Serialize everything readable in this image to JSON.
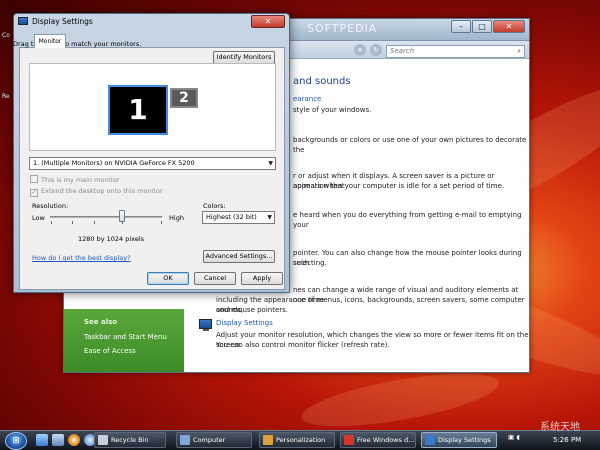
{
  "desktop": {
    "icons": [
      "Co",
      "Re"
    ],
    "watermark": "SOFTPEDIA",
    "corner_watermark": "系统天地"
  },
  "background_window": {
    "search_placeholder": "Search",
    "heading": "and sounds",
    "links": {
      "appearance": "earance",
      "display_settings": "Display Settings"
    },
    "texts": [
      "style of your windows.",
      "backgrounds or colors or use one of your own pictures to decorate the",
      "r or adjust when it displays. A screen saver is a picture or animation that",
      "appears when your computer is idle for a set period of time.",
      "e heard when you do everything from getting e-mail to emptying your",
      "pointer. You can also change how the mouse pointer looks during such",
      "selecting.",
      "nes can change a wide range of visual and auditory elements at one time",
      "including the appearance of menus, icons, backgrounds, screen savers, some computer sounds,",
      "and mouse pointers.",
      "Adjust your monitor resolution, which changes the view so more or fewer items fit on the screen.",
      "You can also control monitor flicker (refresh rate)."
    ],
    "sidebar": {
      "title": "See also",
      "items": [
        "Taskbar and Start Menu",
        "Ease of Access"
      ]
    }
  },
  "dialog": {
    "title": "Display Settings",
    "tab": "Monitor",
    "instruction": "Drag the icons to match your monitors.",
    "identify_button": "Identify Monitors",
    "monitor1_label": "1",
    "monitor2_label": "2",
    "monitor_select": "1. (Multiple Monitors) on NVIDIA GeForce FX 5200",
    "main_monitor_checkbox": "This is my main monitor",
    "extend_desktop_checkbox": "Extend the desktop onto this monitor",
    "resolution_label": "Resolution:",
    "low_label": "Low",
    "high_label": "High",
    "resolution_value": "1280 by 1024 pixels",
    "colors_label": "Colors:",
    "colors_value": "Highest (32 bit)",
    "advanced_button": "Advanced Settings...",
    "help_link": "How do I get the best display?",
    "ok_button": "OK",
    "cancel_button": "Cancel",
    "apply_button": "Apply"
  },
  "taskbar": {
    "items": [
      "Recycle Bin",
      "Computer",
      "Personalization",
      "Free Windows d...",
      "Display Settings"
    ],
    "clock": "5:26 PM"
  }
}
